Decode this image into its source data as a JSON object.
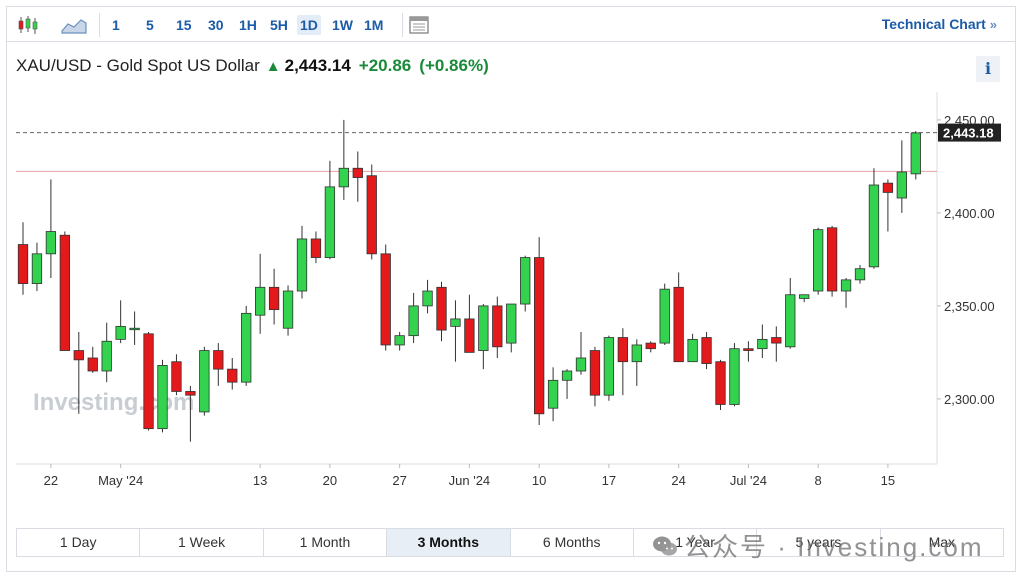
{
  "toolbar": {
    "timeframes": [
      "1",
      "5",
      "15",
      "30",
      "1H",
      "5H",
      "1D",
      "1W",
      "1M"
    ],
    "active_timeframe": "1D",
    "technical_chart_label": "Technical Chart",
    "technical_chart_chevron": "»"
  },
  "header": {
    "instrument": "XAU/USD - Gold Spot US Dollar",
    "price": "2,443.14",
    "change": "+20.86",
    "change_pct": "(+0.86%)",
    "info_label": "i"
  },
  "periods": [
    "1 Day",
    "1 Week",
    "1 Month",
    "3 Months",
    "6 Months",
    "1 Year",
    "5 years",
    "Max"
  ],
  "active_period": "3 Months",
  "watermark": "公众号 · Investing.com",
  "colors": {
    "up": "#33d34f",
    "down": "#e3191c",
    "accent": "#1b5ba7",
    "positive_text": "#1a8a3a"
  },
  "chart_data": {
    "type": "candlestick",
    "logo": "Investing.com",
    "y_ticks": [
      2450,
      2400,
      2350,
      2300
    ],
    "y_tick_labels": [
      "2,450.00",
      "2,400.00",
      "2,350.00",
      "2,300.00"
    ],
    "ylim": [
      2265,
      2465
    ],
    "current_price_label": "2,443.18",
    "current_price": 2443.18,
    "previous_close": 2422.3,
    "x_labels": [
      "22",
      "May '24",
      "13",
      "20",
      "27",
      "Jun '24",
      "10",
      "17",
      "24",
      "Jul '24",
      "8",
      "15"
    ],
    "x_label_index": [
      2,
      7,
      17,
      22,
      27,
      32,
      37,
      42,
      47,
      52,
      57,
      62
    ],
    "candles": [
      [
        2383,
        2395,
        2356,
        2362
      ],
      [
        2362,
        2384,
        2358,
        2378
      ],
      [
        2378,
        2418,
        2365,
        2390
      ],
      [
        2388,
        2390,
        2326,
        2326
      ],
      [
        2326,
        2336,
        2292,
        2321
      ],
      [
        2322,
        2328,
        2314,
        2315
      ],
      [
        2315,
        2341,
        2309,
        2331
      ],
      [
        2332,
        2353,
        2330,
        2339
      ],
      [
        2338,
        2347,
        2329,
        2338
      ],
      [
        2335,
        2336,
        2283,
        2284
      ],
      [
        2284,
        2321,
        2282,
        2318
      ],
      [
        2320,
        2324,
        2302,
        2304
      ],
      [
        2304,
        2307,
        2277,
        2302
      ],
      [
        2293,
        2328,
        2291,
        2326
      ],
      [
        2326,
        2330,
        2307,
        2316
      ],
      [
        2316,
        2322,
        2305,
        2309
      ],
      [
        2309,
        2350,
        2307,
        2346
      ],
      [
        2345,
        2378,
        2335,
        2360
      ],
      [
        2360,
        2370,
        2340,
        2348
      ],
      [
        2338,
        2361,
        2334,
        2358
      ],
      [
        2358,
        2393,
        2354,
        2386
      ],
      [
        2386,
        2390,
        2373,
        2376
      ],
      [
        2376,
        2428,
        2375,
        2414
      ],
      [
        2414,
        2450,
        2407,
        2424
      ],
      [
        2424,
        2433,
        2406,
        2419
      ],
      [
        2420,
        2426,
        2375,
        2378
      ],
      [
        2378,
        2383,
        2326,
        2329
      ],
      [
        2329,
        2336,
        2326,
        2334
      ],
      [
        2334,
        2357,
        2330,
        2350
      ],
      [
        2350,
        2364,
        2346,
        2358
      ],
      [
        2360,
        2363,
        2331,
        2337
      ],
      [
        2339,
        2353,
        2320,
        2343
      ],
      [
        2343,
        2356,
        2325,
        2325
      ],
      [
        2326,
        2351,
        2316,
        2350
      ],
      [
        2350,
        2355,
        2322,
        2328
      ],
      [
        2330,
        2351,
        2325,
        2351
      ],
      [
        2351,
        2377,
        2347,
        2376
      ],
      [
        2376,
        2387,
        2286,
        2292
      ],
      [
        2295,
        2317,
        2288,
        2310
      ],
      [
        2310,
        2316,
        2300,
        2315
      ],
      [
        2315,
        2336,
        2313,
        2322
      ],
      [
        2326,
        2328,
        2296,
        2302
      ],
      [
        2302,
        2334,
        2299,
        2333
      ],
      [
        2333,
        2338,
        2302,
        2320
      ],
      [
        2320,
        2332,
        2307,
        2329
      ],
      [
        2330,
        2331,
        2325,
        2327
      ],
      [
        2330,
        2362,
        2329,
        2359
      ],
      [
        2360,
        2368,
        2323,
        2320
      ],
      [
        2320,
        2335,
        2321,
        2332
      ],
      [
        2333,
        2336,
        2316,
        2319
      ],
      [
        2320,
        2321,
        2294,
        2297
      ],
      [
        2297,
        2330,
        2296,
        2327
      ],
      [
        2327,
        2331,
        2320,
        2326
      ],
      [
        2327,
        2340,
        2322,
        2332
      ],
      [
        2333,
        2339,
        2320,
        2330
      ],
      [
        2328,
        2365,
        2327,
        2356
      ],
      [
        2354,
        2356,
        2352,
        2356
      ],
      [
        2358,
        2392,
        2356,
        2391
      ],
      [
        2392,
        2393,
        2355,
        2358
      ],
      [
        2358,
        2365,
        2349,
        2364
      ],
      [
        2364,
        2372,
        2362,
        2370
      ],
      [
        2371,
        2424,
        2370,
        2415
      ],
      [
        2416,
        2418,
        2390,
        2411
      ],
      [
        2408,
        2439,
        2400,
        2422
      ],
      [
        2421,
        2444,
        2418,
        2443
      ]
    ]
  }
}
